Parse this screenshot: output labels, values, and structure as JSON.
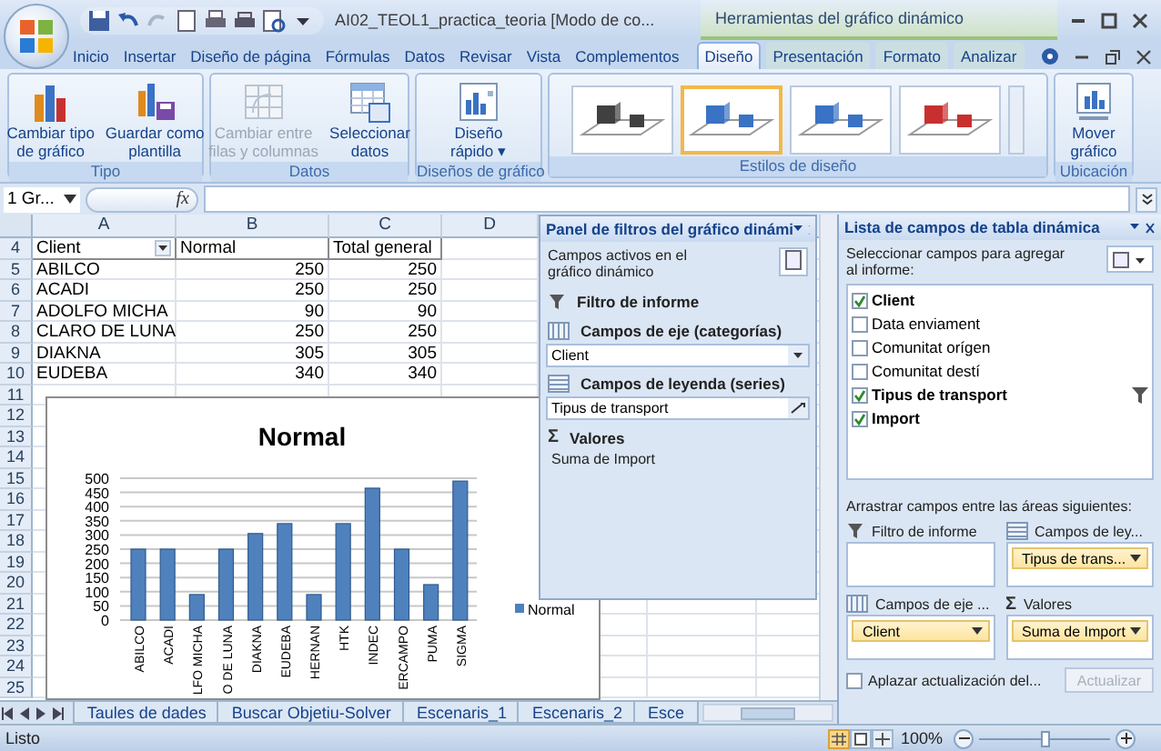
{
  "window": {
    "title": "AI02_TEOL1_practica_teoria  [Modo de co...",
    "context_title": "Herramientas del gráfico dinámico"
  },
  "tabs": [
    {
      "label": "Inicio",
      "selected": false,
      "kind": "standard"
    },
    {
      "label": "Insertar",
      "selected": false,
      "kind": "standard"
    },
    {
      "label": "Diseño de página",
      "selected": false,
      "kind": "standard"
    },
    {
      "label": "Fórmulas",
      "selected": false,
      "kind": "standard"
    },
    {
      "label": "Datos",
      "selected": false,
      "kind": "standard"
    },
    {
      "label": "Revisar",
      "selected": false,
      "kind": "standard"
    },
    {
      "label": "Vista",
      "selected": false,
      "kind": "standard"
    },
    {
      "label": "Complementos",
      "selected": false,
      "kind": "standard"
    },
    {
      "label": "Diseño",
      "selected": true,
      "kind": "contextual"
    },
    {
      "label": "Presentación",
      "selected": false,
      "kind": "contextual"
    },
    {
      "label": "Formato",
      "selected": false,
      "kind": "contextual"
    },
    {
      "label": "Analizar",
      "selected": false,
      "kind": "contextual"
    }
  ],
  "ribbon": {
    "groups": [
      {
        "label": "Tipo",
        "kind": "buttons",
        "buttons": [
          {
            "kind": "chart-type",
            "lines": [
              "Cambiar tipo",
              "de gráfico"
            ],
            "disabled": false
          },
          {
            "kind": "save-template",
            "lines": [
              "Guardar como",
              "plantilla"
            ],
            "disabled": false
          }
        ]
      },
      {
        "label": "Datos",
        "kind": "buttons",
        "buttons": [
          {
            "kind": "switch-rows",
            "lines": [
              "Cambiar entre",
              "filas y columnas"
            ],
            "disabled": true
          },
          {
            "kind": "select-data",
            "lines": [
              "Seleccionar",
              "datos"
            ],
            "disabled": false
          }
        ]
      },
      {
        "label": "Diseños de gráfico",
        "kind": "buttons",
        "buttons": [
          {
            "kind": "quick-layout",
            "lines": [
              "Diseño",
              "rápido ▾"
            ],
            "disabled": false
          }
        ]
      },
      {
        "label": "Estilos de diseño",
        "kind": "gallery",
        "styles": [
          {
            "color": "#404040",
            "selected": false
          },
          {
            "color": "#3a72c4",
            "selected": true
          },
          {
            "color": "#3a72c4",
            "selected": false
          },
          {
            "color": "#c83030",
            "selected": false
          }
        ]
      },
      {
        "label": "Ubicación",
        "kind": "buttons",
        "buttons": [
          {
            "kind": "move-chart",
            "lines": [
              "Mover",
              "gráfico"
            ],
            "disabled": false
          }
        ]
      }
    ]
  },
  "formula_bar": {
    "name_box": "1 Gr...",
    "function_label": "fx"
  },
  "sheet": {
    "columns": [
      "A",
      "B",
      "C",
      "D"
    ],
    "rows": [
      {
        "number": "4",
        "kind": "header",
        "cells": [
          "Client",
          "Normal",
          "Total general"
        ]
      },
      {
        "number": "5",
        "kind": "data",
        "cells": [
          "ABILCO",
          "250",
          "250"
        ]
      },
      {
        "number": "6",
        "kind": "data",
        "cells": [
          "ACADI",
          "250",
          "250"
        ]
      },
      {
        "number": "7",
        "kind": "data",
        "cells": [
          "ADOLFO MICHA",
          "90",
          "90"
        ]
      },
      {
        "number": "8",
        "kind": "data",
        "cells": [
          "CLARO DE LUNA",
          "250",
          "250"
        ]
      },
      {
        "number": "9",
        "kind": "data",
        "cells": [
          "DIAKNA",
          "305",
          "305"
        ]
      },
      {
        "number": "10",
        "kind": "data",
        "cells": [
          "EUDEBA",
          "340",
          "340"
        ]
      },
      {
        "number": "11",
        "kind": "data"
      },
      {
        "number": "12",
        "kind": "data"
      },
      {
        "number": "13",
        "kind": "data"
      },
      {
        "number": "14",
        "kind": "data"
      },
      {
        "number": "15",
        "kind": "data"
      },
      {
        "number": "16",
        "kind": "data"
      },
      {
        "number": "17",
        "kind": "data"
      },
      {
        "number": "18",
        "kind": "data"
      },
      {
        "number": "19",
        "kind": "data"
      },
      {
        "number": "20",
        "kind": "data"
      },
      {
        "number": "21",
        "kind": "data"
      },
      {
        "number": "22",
        "kind": "data"
      },
      {
        "number": "23",
        "kind": "data"
      },
      {
        "number": "24",
        "kind": "data"
      },
      {
        "number": "25",
        "kind": "data"
      }
    ]
  },
  "chart": {
    "chart_data": {
      "type": "bar",
      "title": "Normal",
      "categories": [
        "ABILCO",
        "ACADI",
        "LFO MICHA",
        "O DE LUNA",
        "DIAKNA",
        "EUDEBA",
        "HERNAN",
        "HTK",
        "INDEC",
        "ERCAMPO",
        "PUMA",
        "SIGMA"
      ],
      "series": [
        {
          "name": "Normal",
          "color": "#4f81bd",
          "values": [
            250,
            250,
            90,
            250,
            305,
            340,
            90,
            340,
            465,
            250,
            125,
            490
          ]
        }
      ],
      "ylim": [
        0,
        500
      ],
      "grid": true,
      "yticks": [
        0,
        50,
        100,
        150,
        200,
        250,
        300,
        350,
        400,
        450,
        500
      ]
    }
  },
  "filter_panel": {
    "title": "Panel de filtros del gráfico dinámi",
    "active_label": "Campos activos en el gráfico dinámico",
    "sections": [
      {
        "kind": "filter",
        "label": "Filtro de informe"
      },
      {
        "kind": "axis",
        "label": "Campos de eje (categorías)",
        "value": "Client"
      },
      {
        "kind": "legend",
        "label": "Campos de leyenda (series)",
        "value": "Tipus de transport"
      },
      {
        "kind": "values",
        "label": "Valores",
        "symbol": "Σ",
        "value": "Suma de Import"
      }
    ]
  },
  "field_list": {
    "title": "Lista de campos de tabla dinámica",
    "prompt": "Seleccionar campos para agregar al informe:",
    "fields": [
      {
        "label": "Client",
        "checked": true,
        "filtered": false
      },
      {
        "label": "Data enviament",
        "checked": false,
        "filtered": false
      },
      {
        "label": "Comunitat orígen",
        "checked": false,
        "filtered": false
      },
      {
        "label": "Comunitat destí",
        "checked": false,
        "filtered": false
      },
      {
        "label": "Tipus de transport",
        "checked": true,
        "filtered": true
      },
      {
        "label": "Import",
        "checked": true,
        "filtered": false
      }
    ],
    "drag_prompt": "Arrastrar campos entre las áreas siguientes:",
    "areas": [
      {
        "kind": "filter",
        "label": "Filtro de informe"
      },
      {
        "kind": "legend",
        "label": "Campos de ley...",
        "items": [
          "Tipus de trans..."
        ]
      },
      {
        "kind": "axis",
        "label": "Campos de eje ...",
        "items": [
          "Client"
        ]
      },
      {
        "kind": "values",
        "label": "Valores",
        "symbol": "Σ",
        "items": [
          "Suma de Import"
        ]
      }
    ],
    "defer": {
      "label": "Aplazar actualización del...",
      "checked": false
    },
    "update_button": {
      "label": "Actualizar",
      "disabled": true
    }
  },
  "sheet_tabs": [
    {
      "label": "Taules de dades",
      "selected": false
    },
    {
      "label": "Buscar Objetiu-Solver",
      "selected": false
    },
    {
      "label": "Escenaris_1",
      "selected": false
    },
    {
      "label": "Escenaris_2",
      "selected": false
    },
    {
      "label": "Esce",
      "selected": false
    }
  ],
  "status_bar": {
    "status": "Listo",
    "views": [
      {
        "kind": "normal",
        "selected": true
      },
      {
        "kind": "layout",
        "selected": false
      },
      {
        "kind": "break",
        "selected": false
      }
    ],
    "zoom": "100%",
    "zoom_level": {
      "level": 0.5
    }
  }
}
